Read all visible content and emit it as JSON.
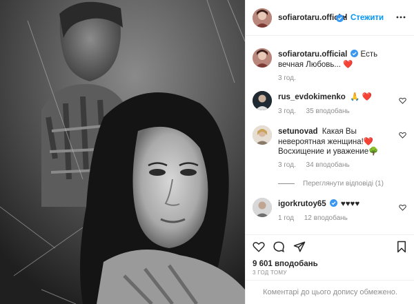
{
  "post": {
    "username": "sofiarotaru.official",
    "follow_label": "Стежити",
    "separator": "•"
  },
  "caption": {
    "username": "sofiarotaru.official",
    "text": "Есть вечная Любовь...",
    "emoji": "❤️",
    "time": "3 год."
  },
  "comments": [
    {
      "username": "rus_evdokimenko",
      "text": "🙏 ❤️",
      "time": "3 год.",
      "likes": "35 вподобань"
    },
    {
      "username": "setunovad",
      "text": "Какая Вы невероятная женщина!❤️ Восхищение и уважение🌳",
      "time": "3 год.",
      "likes": "34 вподобань",
      "replies": "Переглянути відповіді (1)"
    },
    {
      "username": "igorkrutoy65",
      "text": "♥♥♥♥",
      "time": "1 год",
      "likes": "12 вподобань"
    }
  ],
  "footer": {
    "likes": "9 601 вподобань",
    "time": "3 ГОД ТОМУ",
    "comments_disabled": "Коментарі до цього допису обмежено."
  },
  "colors": {
    "accent": "#0095f6",
    "heart": "#ed4956",
    "verified": "#3897f0"
  },
  "icons": [
    "more-icon",
    "heart-icon",
    "comment-icon",
    "share-icon",
    "bookmark-icon",
    "verified-icon"
  ]
}
